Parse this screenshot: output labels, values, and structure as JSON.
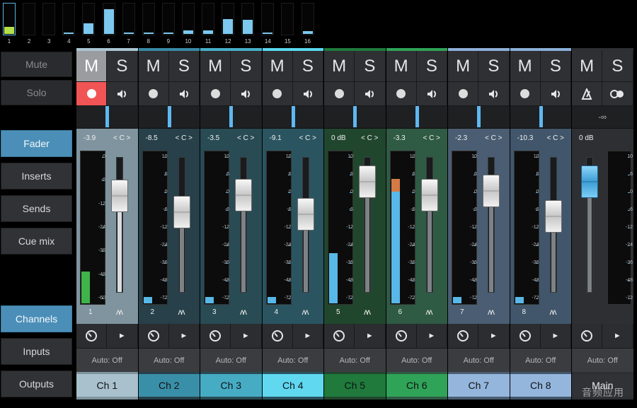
{
  "overview": {
    "numbers": [
      "1",
      "2",
      "3",
      "4",
      "5",
      "6",
      "7",
      "8",
      "9",
      "10",
      "11",
      "12",
      "13",
      "14",
      "15",
      "16"
    ],
    "levels": [
      0.22,
      0,
      0,
      0.04,
      0.33,
      0.8,
      0.04,
      0.04,
      0.04,
      0.11,
      0.11,
      0.48,
      0.45,
      0.04,
      0,
      0.09
    ],
    "selected_index": 0
  },
  "sidebar": {
    "mute_label": "Mute",
    "solo_label": "Solo",
    "fader_label": "Fader",
    "inserts_label": "Inserts",
    "sends_label": "Sends",
    "cue_mix_label": "Cue mix",
    "channels_label": "Channels",
    "inputs_label": "Inputs",
    "outputs_label": "Outputs"
  },
  "common": {
    "mute_letter": "M",
    "solo_letter": "S",
    "pan_center": "< C >",
    "auto_label": "Auto: Off",
    "play_glyph": "►",
    "wave_glyph": "ʌʌ",
    "scale": [
      "10",
      "6",
      "0",
      "-6",
      "-12",
      "-24",
      "-36",
      "-48",
      "-72"
    ],
    "main_scale": [
      "10",
      "6",
      "0",
      "-6",
      "-12",
      "-24",
      "-36",
      "-48",
      "-72"
    ],
    "ch1_scale": [
      "0",
      "-6",
      "-12",
      "-24",
      "-36",
      "-48",
      "-60"
    ]
  },
  "channels": [
    {
      "name": "Ch 1",
      "num": "1",
      "level": "-3.9",
      "fader": 0.78,
      "meter": 0.21,
      "armed": true,
      "mute_active": true,
      "pan": 0.5,
      "bg": "#7f949e",
      "top": "#a9c5d2",
      "name_bg": "#a9c1cc",
      "meter_color": "#3fb44a"
    },
    {
      "name": "Ch 2",
      "num": "2",
      "level": "-8.5",
      "fader": 0.62,
      "meter": 0.04,
      "armed": false,
      "mute_active": false,
      "pan": 0.5,
      "bg": "#27404a",
      "top": "#3a8aa6",
      "name_bg": "#3a8fa8",
      "meter_color": "#58b8e8"
    },
    {
      "name": "Ch 3",
      "num": "3",
      "level": "-3.5",
      "fader": 0.79,
      "meter": 0.04,
      "armed": false,
      "mute_active": false,
      "pan": 0.5,
      "bg": "#284b54",
      "top": "#48b0c8",
      "name_bg": "#46acc4",
      "meter_color": "#58b8e8"
    },
    {
      "name": "Ch 4",
      "num": "4",
      "level": "-9.1",
      "fader": 0.6,
      "meter": 0.04,
      "armed": false,
      "mute_active": false,
      "pan": 0.5,
      "bg": "#2a5560",
      "top": "#5ad8ef",
      "name_bg": "#5fd8f0",
      "meter_color": "#58b8e8"
    },
    {
      "name": "Ch 5",
      "num": "5",
      "level": "0 dB",
      "fader": 0.92,
      "meter": 0.33,
      "armed": false,
      "mute_active": false,
      "pan": 0.5,
      "bg": "#21462e",
      "top": "#1f7a3c",
      "name_bg": "#1f7a3c",
      "meter_color": "#58b8e8"
    },
    {
      "name": "Ch 6",
      "num": "6",
      "level": "-3.3",
      "fader": 0.79,
      "meter": 0.82,
      "armed": false,
      "mute_active": false,
      "pan": 0.5,
      "bg": "#2f5a44",
      "top": "#2fa357",
      "name_bg": "#2fa357",
      "meter_color": "#58b8e8"
    },
    {
      "name": "Ch 7",
      "num": "7",
      "level": "-2.3",
      "fader": 0.83,
      "meter": 0.04,
      "armed": false,
      "mute_active": false,
      "pan": 0.5,
      "bg": "#4a5d72",
      "top": "#8fb0d8",
      "name_bg": "#95b6dc",
      "meter_color": "#58b8e8"
    },
    {
      "name": "Ch 8",
      "num": "8",
      "level": "-10.3",
      "fader": 0.58,
      "meter": 0.04,
      "armed": false,
      "mute_active": false,
      "pan": 0.5,
      "bg": "#41566a",
      "top": "#8ab0d8",
      "name_bg": "#95b6dc",
      "meter_color": "#58b8e8"
    }
  ],
  "main": {
    "name": "Main",
    "level": "0 dB",
    "pan_text": "-∞",
    "fader": 0.92,
    "bg": "#2d2f32",
    "name_bg": "#303236"
  },
  "watermark": "音频应用"
}
